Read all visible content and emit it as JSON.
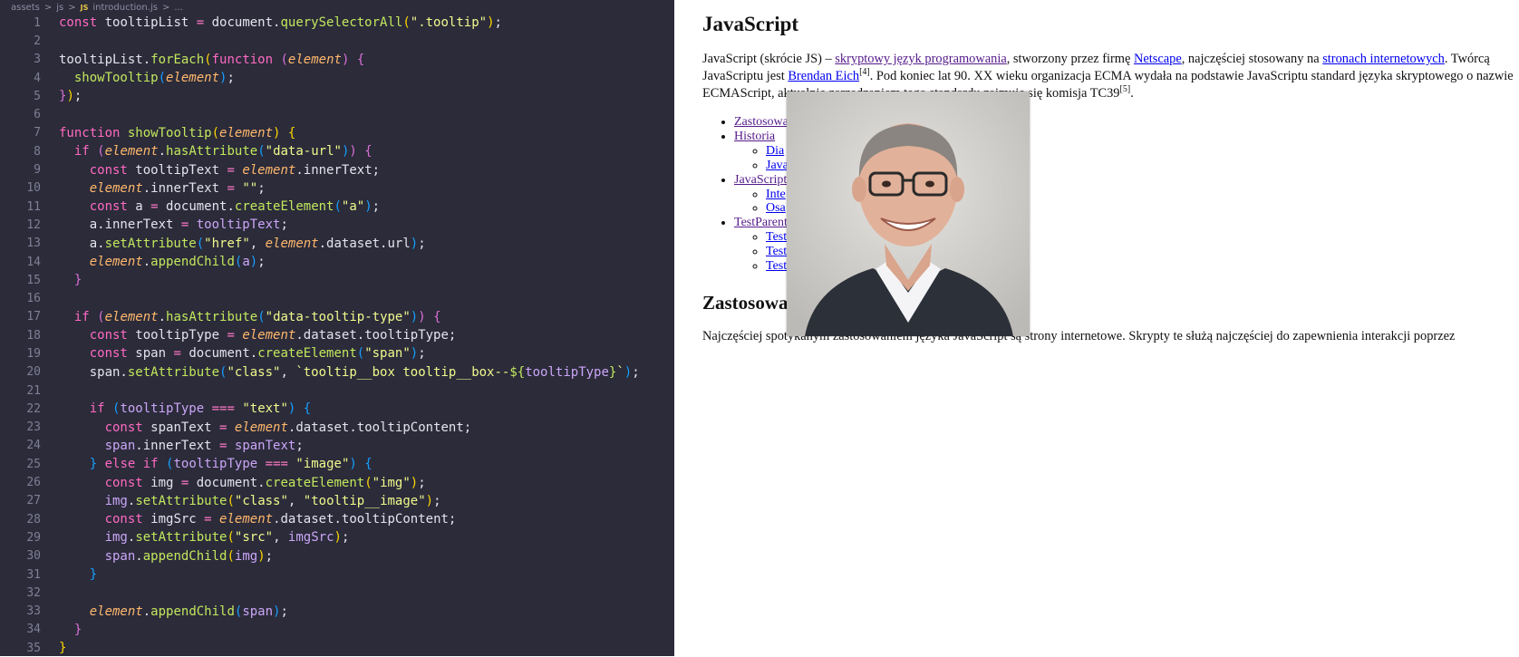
{
  "editor": {
    "breadcrumb": [
      "assets",
      ">",
      "js",
      ">",
      "JS",
      "introduction.js",
      ">",
      "..."
    ],
    "lines": [
      {
        "n": "1",
        "t": [
          [
            "kw",
            "const"
          ],
          [
            "",
            " tooltipList "
          ],
          [
            "op",
            "="
          ],
          [
            "",
            " document."
          ],
          [
            "fn",
            "querySelectorAll"
          ],
          [
            "br1",
            "("
          ],
          [
            "str",
            "\".tooltip\""
          ],
          [
            "br1",
            ")"
          ],
          [
            "",
            ";"
          ]
        ]
      },
      {
        "n": "2",
        "t": []
      },
      {
        "n": "3",
        "t": [
          [
            "",
            "tooltipList."
          ],
          [
            "fn",
            "forEach"
          ],
          [
            "br1",
            "("
          ],
          [
            "kw",
            "function"
          ],
          [
            "",
            " "
          ],
          [
            "br2",
            "("
          ],
          [
            "it",
            "element"
          ],
          [
            "br2",
            ")"
          ],
          [
            "",
            " "
          ],
          [
            "br2",
            "{"
          ]
        ]
      },
      {
        "n": "4",
        "t": [
          [
            "",
            "  "
          ],
          [
            "fn",
            "showTooltip"
          ],
          [
            "br3",
            "("
          ],
          [
            "it",
            "element"
          ],
          [
            "br3",
            ")"
          ],
          [
            "",
            ";"
          ]
        ]
      },
      {
        "n": "5",
        "t": [
          [
            "br2",
            "}"
          ],
          [
            "br1",
            ")"
          ],
          [
            "",
            ";"
          ]
        ]
      },
      {
        "n": "6",
        "t": []
      },
      {
        "n": "7",
        "t": [
          [
            "kw",
            "function"
          ],
          [
            "",
            " "
          ],
          [
            "fn",
            "showTooltip"
          ],
          [
            "br1",
            "("
          ],
          [
            "it",
            "element"
          ],
          [
            "br1",
            ")"
          ],
          [
            "",
            " "
          ],
          [
            "br1",
            "{"
          ]
        ]
      },
      {
        "n": "8",
        "t": [
          [
            "",
            "  "
          ],
          [
            "kw",
            "if"
          ],
          [
            "",
            " "
          ],
          [
            "br2",
            "("
          ],
          [
            "it",
            "element"
          ],
          [
            "",
            "."
          ],
          [
            "fn",
            "hasAttribute"
          ],
          [
            "br3",
            "("
          ],
          [
            "str",
            "\"data-url\""
          ],
          [
            "br3",
            ")"
          ],
          [
            "br2",
            ")"
          ],
          [
            "",
            " "
          ],
          [
            "br2",
            "{"
          ]
        ]
      },
      {
        "n": "9",
        "t": [
          [
            "",
            "    "
          ],
          [
            "kw",
            "const"
          ],
          [
            "",
            " tooltipText "
          ],
          [
            "op",
            "="
          ],
          [
            "",
            " "
          ],
          [
            "it",
            "element"
          ],
          [
            "",
            ".innerText;"
          ]
        ]
      },
      {
        "n": "10",
        "t": [
          [
            "",
            "    "
          ],
          [
            "it",
            "element"
          ],
          [
            "",
            ".innerText "
          ],
          [
            "op",
            "="
          ],
          [
            "",
            " "
          ],
          [
            "str",
            "\"\""
          ],
          [
            "",
            ";"
          ]
        ]
      },
      {
        "n": "11",
        "t": [
          [
            "",
            "    "
          ],
          [
            "kw",
            "const"
          ],
          [
            "",
            " a "
          ],
          [
            "op",
            "="
          ],
          [
            "",
            " document."
          ],
          [
            "fn",
            "createElement"
          ],
          [
            "br3",
            "("
          ],
          [
            "str",
            "\"a\""
          ],
          [
            "br3",
            ")"
          ],
          [
            "",
            ";"
          ]
        ]
      },
      {
        "n": "12",
        "t": [
          [
            "",
            "    a.innerText "
          ],
          [
            "op",
            "="
          ],
          [
            "",
            " "
          ],
          [
            "vr",
            "tooltipText"
          ],
          [
            "",
            ";"
          ]
        ]
      },
      {
        "n": "13",
        "t": [
          [
            "",
            "    a."
          ],
          [
            "fn",
            "setAttribute"
          ],
          [
            "br3",
            "("
          ],
          [
            "str",
            "\"href\""
          ],
          [
            "",
            ", "
          ],
          [
            "it",
            "element"
          ],
          [
            "",
            ".dataset.url"
          ],
          [
            "br3",
            ")"
          ],
          [
            "",
            ";"
          ]
        ]
      },
      {
        "n": "14",
        "t": [
          [
            "",
            "    "
          ],
          [
            "it",
            "element"
          ],
          [
            "",
            "."
          ],
          [
            "fn",
            "appendChild"
          ],
          [
            "br3",
            "("
          ],
          [
            "vr",
            "a"
          ],
          [
            "br3",
            ")"
          ],
          [
            "",
            ";"
          ]
        ]
      },
      {
        "n": "15",
        "t": [
          [
            "",
            "  "
          ],
          [
            "br2",
            "}"
          ]
        ]
      },
      {
        "n": "16",
        "t": []
      },
      {
        "n": "17",
        "t": [
          [
            "",
            "  "
          ],
          [
            "kw",
            "if"
          ],
          [
            "",
            " "
          ],
          [
            "br2",
            "("
          ],
          [
            "it",
            "element"
          ],
          [
            "",
            "."
          ],
          [
            "fn",
            "hasAttribute"
          ],
          [
            "br3",
            "("
          ],
          [
            "str",
            "\"data-tooltip-type\""
          ],
          [
            "br3",
            ")"
          ],
          [
            "br2",
            ")"
          ],
          [
            "",
            " "
          ],
          [
            "br2",
            "{"
          ]
        ]
      },
      {
        "n": "18",
        "t": [
          [
            "",
            "    "
          ],
          [
            "kw",
            "const"
          ],
          [
            "",
            " tooltipType "
          ],
          [
            "op",
            "="
          ],
          [
            "",
            " "
          ],
          [
            "it",
            "element"
          ],
          [
            "",
            ".dataset.tooltipType;"
          ]
        ]
      },
      {
        "n": "19",
        "t": [
          [
            "",
            "    "
          ],
          [
            "kw",
            "const"
          ],
          [
            "",
            " span "
          ],
          [
            "op",
            "="
          ],
          [
            "",
            " document."
          ],
          [
            "fn",
            "createElement"
          ],
          [
            "br3",
            "("
          ],
          [
            "str",
            "\"span\""
          ],
          [
            "br3",
            ")"
          ],
          [
            "",
            ";"
          ]
        ]
      },
      {
        "n": "20",
        "t": [
          [
            "",
            "    span."
          ],
          [
            "fn",
            "setAttribute"
          ],
          [
            "br3",
            "("
          ],
          [
            "str",
            "\"class\""
          ],
          [
            "",
            ", "
          ],
          [
            "str",
            "`tooltip__box tooltip__box--"
          ],
          [
            "fn",
            "${"
          ],
          [
            "vr",
            "tooltipType"
          ],
          [
            "fn",
            "}"
          ],
          [
            "str",
            "`"
          ],
          [
            "br3",
            ")"
          ],
          [
            "",
            ";"
          ]
        ]
      },
      {
        "n": "21",
        "t": []
      },
      {
        "n": "22",
        "t": [
          [
            "",
            "    "
          ],
          [
            "kw",
            "if"
          ],
          [
            "",
            " "
          ],
          [
            "br3",
            "("
          ],
          [
            "vr",
            "tooltipType"
          ],
          [
            "",
            " "
          ],
          [
            "op",
            "==="
          ],
          [
            "",
            " "
          ],
          [
            "str",
            "\"text\""
          ],
          [
            "br3",
            ")"
          ],
          [
            "",
            " "
          ],
          [
            "br3",
            "{"
          ]
        ]
      },
      {
        "n": "23",
        "t": [
          [
            "",
            "      "
          ],
          [
            "kw",
            "const"
          ],
          [
            "",
            " spanText "
          ],
          [
            "op",
            "="
          ],
          [
            "",
            " "
          ],
          [
            "it",
            "element"
          ],
          [
            "",
            ".dataset.tooltipContent;"
          ]
        ]
      },
      {
        "n": "24",
        "t": [
          [
            "",
            "      "
          ],
          [
            "vr",
            "span"
          ],
          [
            "",
            ".innerText "
          ],
          [
            "op",
            "="
          ],
          [
            "",
            " "
          ],
          [
            "vr",
            "spanText"
          ],
          [
            "",
            ";"
          ]
        ]
      },
      {
        "n": "25",
        "t": [
          [
            "",
            "    "
          ],
          [
            "br3",
            "}"
          ],
          [
            "",
            " "
          ],
          [
            "kw",
            "else if"
          ],
          [
            "",
            " "
          ],
          [
            "br3",
            "("
          ],
          [
            "vr",
            "tooltipType"
          ],
          [
            "",
            " "
          ],
          [
            "op",
            "==="
          ],
          [
            "",
            " "
          ],
          [
            "str",
            "\"image\""
          ],
          [
            "br3",
            ")"
          ],
          [
            "",
            " "
          ],
          [
            "br3",
            "{"
          ]
        ]
      },
      {
        "n": "26",
        "t": [
          [
            "",
            "      "
          ],
          [
            "kw",
            "const"
          ],
          [
            "",
            " img "
          ],
          [
            "op",
            "="
          ],
          [
            "",
            " document."
          ],
          [
            "fn",
            "createElement"
          ],
          [
            "br1",
            "("
          ],
          [
            "str",
            "\"img\""
          ],
          [
            "br1",
            ")"
          ],
          [
            "",
            ";"
          ]
        ]
      },
      {
        "n": "27",
        "t": [
          [
            "",
            "      "
          ],
          [
            "vr",
            "img"
          ],
          [
            "",
            "."
          ],
          [
            "fn",
            "setAttribute"
          ],
          [
            "br1",
            "("
          ],
          [
            "str",
            "\"class\""
          ],
          [
            "",
            ", "
          ],
          [
            "str",
            "\"tooltip__image\""
          ],
          [
            "br1",
            ")"
          ],
          [
            "",
            ";"
          ]
        ]
      },
      {
        "n": "28",
        "t": [
          [
            "",
            "      "
          ],
          [
            "kw",
            "const"
          ],
          [
            "",
            " imgSrc "
          ],
          [
            "op",
            "="
          ],
          [
            "",
            " "
          ],
          [
            "it",
            "element"
          ],
          [
            "",
            ".dataset.tooltipContent;"
          ]
        ]
      },
      {
        "n": "29",
        "t": [
          [
            "",
            "      "
          ],
          [
            "vr",
            "img"
          ],
          [
            "",
            "."
          ],
          [
            "fn",
            "setAttribute"
          ],
          [
            "br1",
            "("
          ],
          [
            "str",
            "\"src\""
          ],
          [
            "",
            ", "
          ],
          [
            "vr",
            "imgSrc"
          ],
          [
            "br1",
            ")"
          ],
          [
            "",
            ";"
          ]
        ]
      },
      {
        "n": "30",
        "t": [
          [
            "",
            "      "
          ],
          [
            "vr",
            "span"
          ],
          [
            "",
            "."
          ],
          [
            "fn",
            "appendChild"
          ],
          [
            "br1",
            "("
          ],
          [
            "vr",
            "img"
          ],
          [
            "br1",
            ")"
          ],
          [
            "",
            ";"
          ]
        ]
      },
      {
        "n": "31",
        "t": [
          [
            "",
            "    "
          ],
          [
            "br3",
            "}"
          ]
        ]
      },
      {
        "n": "32",
        "t": []
      },
      {
        "n": "33",
        "t": [
          [
            "",
            "    "
          ],
          [
            "it",
            "element"
          ],
          [
            "",
            "."
          ],
          [
            "fn",
            "appendChild"
          ],
          [
            "br3",
            "("
          ],
          [
            "vr",
            "span"
          ],
          [
            "br3",
            ")"
          ],
          [
            "",
            ";"
          ]
        ]
      },
      {
        "n": "34",
        "t": [
          [
            "",
            "  "
          ],
          [
            "br2",
            "}"
          ]
        ]
      },
      {
        "n": "35",
        "t": [
          [
            "br1",
            "}"
          ]
        ]
      }
    ]
  },
  "browser": {
    "title": "JavaScript",
    "intro": {
      "p1": "JavaScript (skrócie JS) – ",
      "link1": "skryptowy język programowania",
      "p2": ", stworzony przez firmę ",
      "link2": "Netscape",
      "p3": ", najczęściej stosowany na ",
      "link3": "stronach internetowych",
      "p4": ". Twórcą JavaScriptu jest ",
      "link4": "Brendan Eich",
      "sup1": "[4]",
      "p5": ". Pod koniec lat 90. XX wieku organizacja ECMA wydała na podstawie JavaScriptu standard języka skryptowego o nazwie ECMAScript, aktualnie zarządzaniem tego standardu zajmuje się komisja TC39",
      "sup2": "[5]",
      "p6": "."
    },
    "toc": {
      "i1": "Zastosowa",
      "i2": "Historia",
      "i2a": "Dia",
      "i2b": "Java",
      "i3": "JavaScript",
      "i3a": "Inte",
      "i3b": "Osa",
      "i4": "TestParent",
      "i4a": "Test",
      "i4b": "Test",
      "i4c": "Test"
    },
    "h2": "Zastosowa",
    "para2": "Najczęściej spotykanym zastosowaniem języka JavaScript są strony internetowe. Skrypty te służą najczęściej do zapewnienia interakcji poprzez"
  }
}
